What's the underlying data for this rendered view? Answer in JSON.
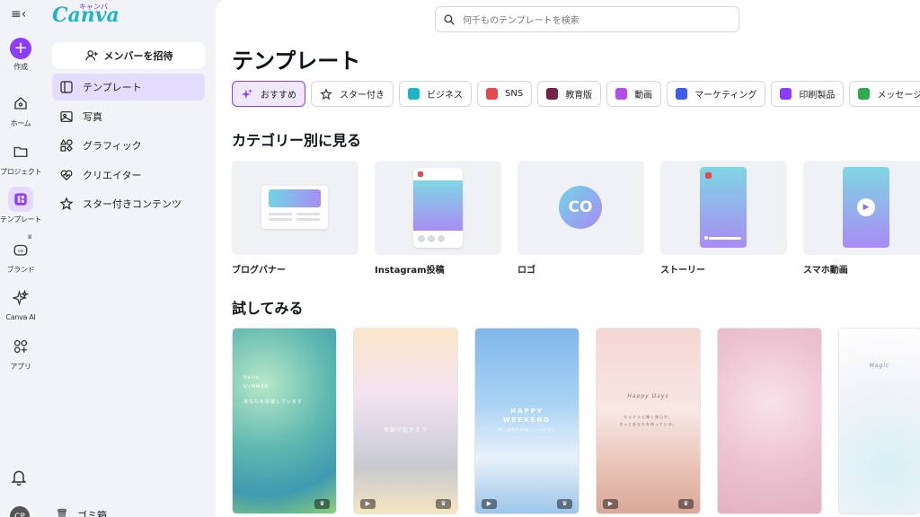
{
  "rail": {
    "menu_icon": "≡‹",
    "items": [
      {
        "label": "作成"
      },
      {
        "label": "ホーム"
      },
      {
        "label": "プロジェクト"
      },
      {
        "label": "テンプレート"
      },
      {
        "label": "ブランド"
      },
      {
        "label": "Canva AI"
      },
      {
        "label": "アプリ"
      }
    ],
    "avatar": "CP"
  },
  "panel": {
    "logo": "Canva",
    "logo_sub": "キャンバ",
    "invite": "メンバーを招待",
    "nav": [
      {
        "label": "テンプレート"
      },
      {
        "label": "写真"
      },
      {
        "label": "グラフィック"
      },
      {
        "label": "クリエイター"
      },
      {
        "label": "スター付きコンテンツ"
      }
    ],
    "trash": "ゴミ箱"
  },
  "main": {
    "search_placeholder": "何千ものテンプレートを検索",
    "title": "テンプレート",
    "chips": [
      {
        "label": "おすすめ",
        "color": "#8b3dff"
      },
      {
        "label": "スター付き",
        "color": "#333333"
      },
      {
        "label": "ビジネス",
        "color": "#1fb5c8"
      },
      {
        "label": "SNS",
        "color": "#e5484d"
      },
      {
        "label": "教育版",
        "color": "#7a1f4a"
      },
      {
        "label": "動画",
        "color": "#b44bea"
      },
      {
        "label": "マーケティング",
        "color": "#3d5cf0"
      },
      {
        "label": "印刷製品",
        "color": "#8b3dff"
      },
      {
        "label": "メッセージカード",
        "color": "#2eaa4f"
      }
    ],
    "categories_heading": "カテゴリー別に見る",
    "categories": [
      {
        "label": "ブログバナー"
      },
      {
        "label": "Instagram投稿"
      },
      {
        "label": "ロゴ",
        "logo_text": "CO"
      },
      {
        "label": "ストーリー"
      },
      {
        "label": "スマホ動画"
      }
    ],
    "try_heading": "試してみる",
    "tries": [
      {
        "line1": "Hello",
        "line2": "SUMMER",
        "line3": "あなたを応援しています"
      },
      {
        "line1": "奇跡が起きそう"
      },
      {
        "line1": "HAPPY",
        "line2": "WEEKEND",
        "line3": "良い週末をお過ごしください"
      },
      {
        "line1": "Happy Days",
        "line2": "キラキラと輝く毎日が、",
        "line3": "きっとあなたを待っている。"
      },
      {},
      {
        "line1": "Magic"
      }
    ]
  }
}
